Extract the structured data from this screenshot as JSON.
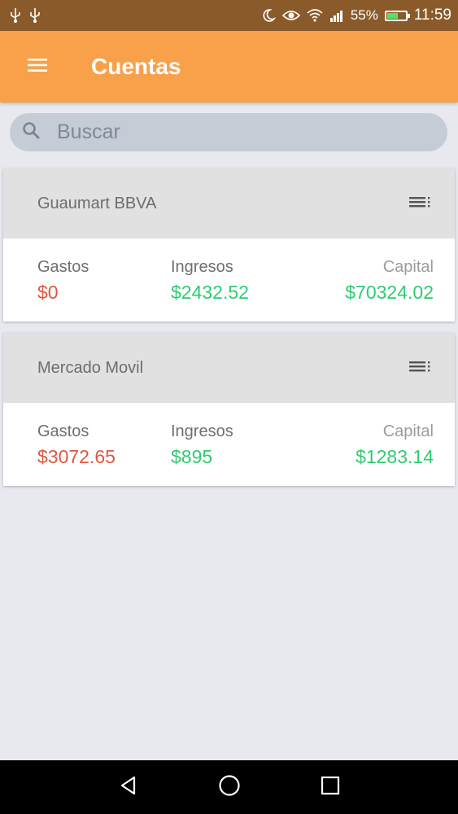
{
  "status_bar": {
    "battery_percent": "55%",
    "battery_level": 0.55,
    "time": "11:59",
    "icons": [
      "usb-icon",
      "usb-icon",
      "moon-icon",
      "eye-icon",
      "wifi-icon",
      "signal-icon",
      "battery-charging-icon"
    ]
  },
  "app_bar": {
    "title": "Cuentas",
    "menu_icon": "hamburger-menu-icon",
    "color": "#f9a04a"
  },
  "search": {
    "placeholder": "Buscar",
    "value": "",
    "icon": "search-icon"
  },
  "accounts": [
    {
      "name": "Guaumart BBVA",
      "gastos_label": "Gastos",
      "gastos": "$0",
      "ingresos_label": "Ingresos",
      "ingresos": "$2432.52",
      "capital_label": "Capital",
      "capital": "$70324.02"
    },
    {
      "name": "Mercado Movil",
      "gastos_label": "Gastos",
      "gastos": "$3072.65",
      "ingresos_label": "Ingresos",
      "ingresos": "$895",
      "capital_label": "Capital",
      "capital": "$1283.14"
    }
  ],
  "colors": {
    "expense": "#e0573f",
    "income": "#2ecc71",
    "status_bar": "#8a5a2b"
  },
  "nav_bar": {
    "icons": [
      "back-icon",
      "home-icon",
      "recents-icon"
    ]
  }
}
